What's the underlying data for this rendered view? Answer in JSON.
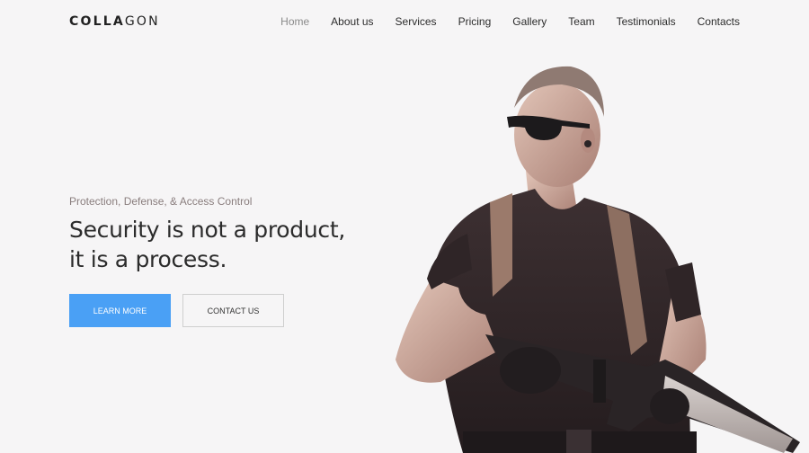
{
  "brand": {
    "logo_text_bold": "COLLA",
    "logo_text_thin": "GON"
  },
  "nav": {
    "items": [
      {
        "label": "Home",
        "active": true
      },
      {
        "label": "About us"
      },
      {
        "label": "Services"
      },
      {
        "label": "Pricing"
      },
      {
        "label": "Gallery"
      },
      {
        "label": "Team"
      },
      {
        "label": "Testimonials"
      },
      {
        "label": "Contacts"
      }
    ]
  },
  "hero": {
    "kicker": "Protection, Defense, & Access Control",
    "headline_line1": "Security is not a product,",
    "headline_line2": "it is a process.",
    "primary_button": "LEARN MORE",
    "secondary_button": "CONTACT US"
  },
  "colors": {
    "background": "#f6f5f6",
    "accent": "#4aa0f5",
    "nav_active": "#8a8a8a",
    "text_dark": "#2b2b2b"
  }
}
